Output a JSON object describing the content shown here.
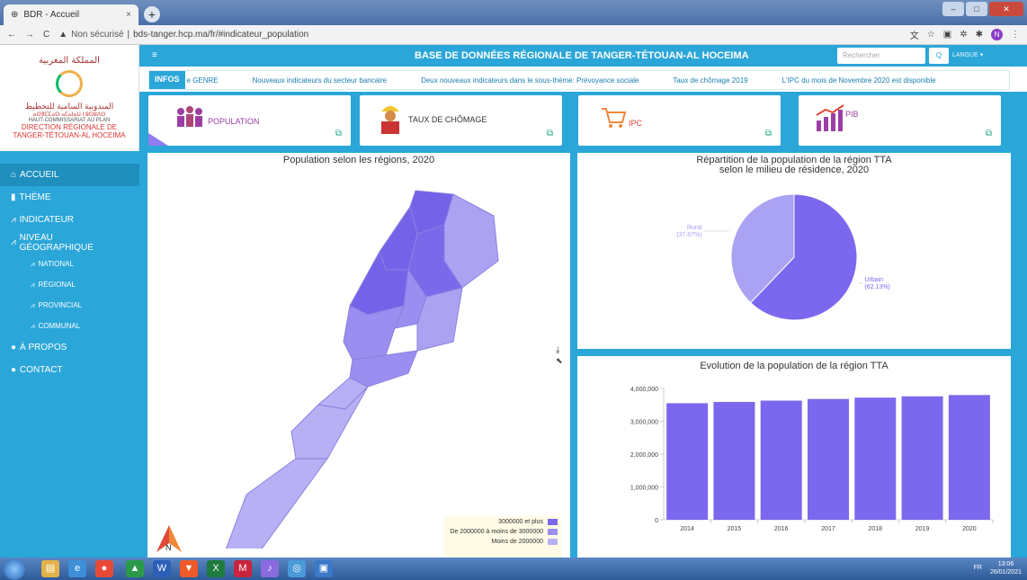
{
  "browser": {
    "tab_title": "BDR - Accueil",
    "tab_close": "×",
    "new_tab": "+",
    "nonsecure": "Non sécurisé",
    "url": "bds-tanger.hcp.ma/fr/#indicateur_population",
    "profile_initial": "N"
  },
  "sidebar": {
    "logo": {
      "arabic_kingdom": "المملكة المغربية",
      "arabic_hcp": "المندوبية السامية للتخطيط",
      "tifinagh": "ⴰⵙⴻⵎⵎⴰⵔ ⴰⵎⴰⵏⴰⵡ ⵏ ⵓⵙⵓⴷⵙ",
      "hcp": "HAUT-COMMISSARIAT AU PLAN",
      "direction": "DIRECTION RÉGIONALE DE",
      "region": "TANGER-TÉTOUAN-AL HOCEIMA"
    },
    "items": [
      {
        "label": "ACCUEIL",
        "icon": "home-icon"
      },
      {
        "label": "THÈME",
        "icon": "bookmark-icon"
      },
      {
        "label": "INDICATEUR",
        "icon": "line-chart-icon"
      },
      {
        "label": "NIVEAU GÉOGRAPHIQUE",
        "icon": "line-chart-icon"
      },
      {
        "label": "NATIONAL",
        "icon": "line-chart-icon"
      },
      {
        "label": "RÉGIONAL",
        "icon": "line-chart-icon"
      },
      {
        "label": "PROVINCIAL",
        "icon": "line-chart-icon"
      },
      {
        "label": "COMMUNAL",
        "icon": "line-chart-icon"
      },
      {
        "label": "À PROPOS",
        "icon": "info-icon"
      },
      {
        "label": "CONTACT",
        "icon": "info-icon"
      }
    ]
  },
  "header": {
    "menu_glyph": "≡",
    "title": "BASE DE DONNÉES RÉGIONALE DE TANGER-TÉTOUAN-AL HOCEIMA",
    "search_placeholder": "Rechercher",
    "search_button": "Q",
    "langue": "LANGUE ▾"
  },
  "ticker": {
    "label": "INFOS",
    "items": [
      "e GENRE",
      "Nouveaux indicateurs du secteur bancaire",
      "Deux nouveaux indicateurs dans le sous-thème: Prévoyance sociale",
      "Taux de chômage 2019",
      "L'IPC du mois de Novembre 2020 est disponible"
    ]
  },
  "cards": [
    {
      "label": "POPULATION",
      "icon": "people-icon",
      "color": "#9b3fa5"
    },
    {
      "label": "TAUX DE CHÔMAGE",
      "icon": "worker-icon",
      "color": "#333333"
    },
    {
      "label": "IPC",
      "icon": "cart-icon",
      "color": "#e0493a"
    },
    {
      "label": "PIB",
      "icon": "bar-growth-icon",
      "color": "#9b3fa5"
    }
  ],
  "map_panel": {
    "title": "Population selon les régions, 2020",
    "download_glyph": "⤓",
    "legend": [
      {
        "label": "3000000 et plus",
        "color": "#7b68ee"
      },
      {
        "label": "De 2000000 à moins de 3000000",
        "color": "#9b8ef0"
      },
      {
        "label": "Moins de 2000000",
        "color": "#b8b0f4"
      }
    ],
    "north": "N"
  },
  "chart_data": [
    {
      "type": "pie",
      "title": "Répartition  de la population de la région TTA",
      "subtitle": "selon le milieu de résidence, 2020",
      "slices": [
        {
          "label": "Urbain",
          "display": "(62.13%)",
          "value": 62.13,
          "color": "#7b68ee"
        },
        {
          "label": "Rural",
          "display": "(37.87%)",
          "value": 37.87,
          "color": "#aaa2f2"
        }
      ]
    },
    {
      "type": "bar",
      "title": "Evolution de la population de la région TTA",
      "categories": [
        "2014",
        "2015",
        "2016",
        "2017",
        "2018",
        "2019",
        "2020"
      ],
      "values": [
        3550000,
        3590000,
        3630000,
        3680000,
        3720000,
        3760000,
        3800000
      ],
      "ylim": [
        0,
        4000000
      ],
      "yticks": [
        "0",
        "1,000,000",
        "2,000,000",
        "3,000,000",
        "4,000,000"
      ],
      "color": "#7b68ee"
    }
  ],
  "taskbar": {
    "lang": "FR",
    "time": "13:06",
    "date": "26/01/2021"
  }
}
